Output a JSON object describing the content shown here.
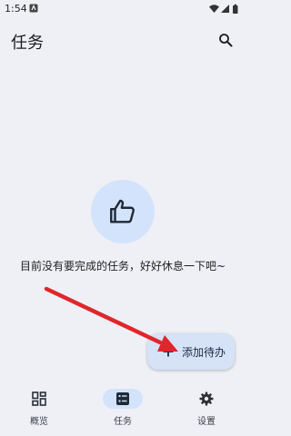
{
  "status_bar": {
    "time": "1:54",
    "app_icon": "notification-app-icon",
    "right_icons": [
      "wifi-icon",
      "signal-icon",
      "battery-icon"
    ]
  },
  "app_bar": {
    "title": "任务",
    "search_icon": "search-icon"
  },
  "empty_state": {
    "icon": "thumbs-up-icon",
    "message": "目前没有要完成的任务，好好休息一下吧~"
  },
  "fab": {
    "icon": "plus-icon",
    "label": "添加待办"
  },
  "annotation": {
    "arrow_color": "#e0262b"
  },
  "bottom_nav": {
    "items": [
      {
        "label": "概览",
        "icon": "overview-grid-icon",
        "active": false
      },
      {
        "label": "任务",
        "icon": "task-list-icon",
        "active": true
      },
      {
        "label": "设置",
        "icon": "gear-icon",
        "active": false
      }
    ]
  },
  "colors": {
    "background": "#eef0f6",
    "accent_container": "#d3e3fb",
    "fab_container": "#d6e2f6"
  }
}
